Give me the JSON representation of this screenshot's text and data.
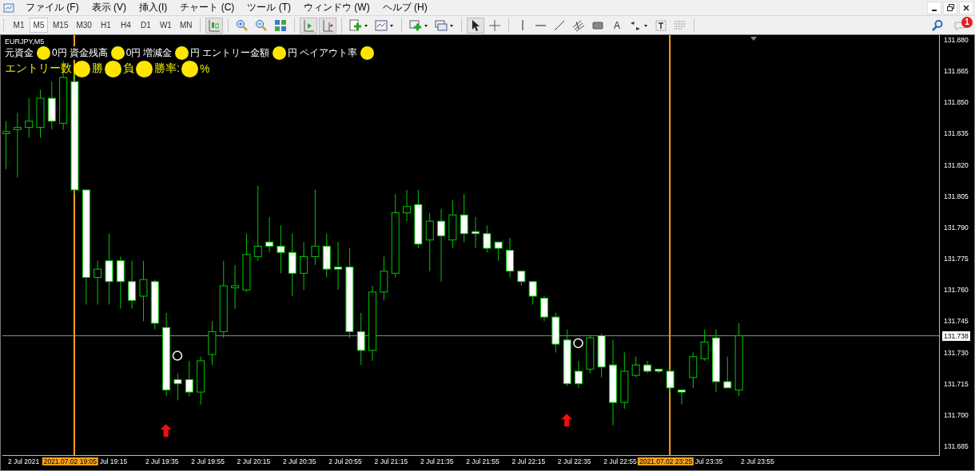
{
  "menu": [
    {
      "label": "ファイル (F)"
    },
    {
      "label": "表示 (V)"
    },
    {
      "label": "挿入(I)"
    },
    {
      "label": "チャート (C)"
    },
    {
      "label": "ツール (T)"
    },
    {
      "label": "ウィンドウ (W)"
    },
    {
      "label": "ヘルプ (H)"
    }
  ],
  "timeframes": [
    {
      "label": "M1",
      "selected": false
    },
    {
      "label": "M5",
      "selected": true
    },
    {
      "label": "M15",
      "selected": false
    },
    {
      "label": "M30",
      "selected": false
    },
    {
      "label": "H1",
      "selected": false
    },
    {
      "label": "H4",
      "selected": false
    },
    {
      "label": "D1",
      "selected": false
    },
    {
      "label": "W1",
      "selected": false
    },
    {
      "label": "MN",
      "selected": false
    }
  ],
  "text_tool_label": "A",
  "notifications": {
    "count": "1"
  },
  "chart": {
    "symbol": "EURJPY,M5",
    "info_line": [
      {
        "kind": "text",
        "text": "元資金 "
      },
      {
        "kind": "dot"
      },
      {
        "kind": "text",
        "text": "0円"
      },
      {
        "kind": "text",
        "text": "資金残高"
      },
      {
        "kind": "dot"
      },
      {
        "kind": "text",
        "text": "0円"
      },
      {
        "kind": "text",
        "text": "増減金"
      },
      {
        "kind": "dot"
      },
      {
        "kind": "text",
        "text": "円"
      },
      {
        "kind": "text",
        "text": "エントリー金額"
      },
      {
        "kind": "dot"
      },
      {
        "kind": "text",
        "text": "円"
      },
      {
        "kind": "text",
        "text": "ペイアウト率"
      },
      {
        "kind": "dot"
      }
    ],
    "stats_line": [
      {
        "kind": "text",
        "text": "エントリー数"
      },
      {
        "kind": "dot"
      },
      {
        "kind": "text",
        "text": "勝"
      },
      {
        "kind": "dot"
      },
      {
        "kind": "text",
        "text": "負"
      },
      {
        "kind": "dot"
      },
      {
        "kind": "text",
        "text": "勝率:"
      },
      {
        "kind": "dot"
      },
      {
        "kind": "text",
        "text": "%"
      }
    ],
    "price_ticks": [
      "131.880",
      "131.865",
      "131.850",
      "131.835",
      "131.820",
      "131.805",
      "131.790",
      "131.775",
      "131.760",
      "131.745",
      "131.730",
      "131.715",
      "131.700",
      "131.685"
    ],
    "current_price": "131.738",
    "time_labels": [
      "2 Jul 2021",
      "Jul 19:15",
      "2 Jul 19:35",
      "2 Jul 19:55",
      "2 Jul 20:15",
      "2 Jul 20:35",
      "2 Jul 20:55",
      "2 Jul 21:15",
      "2 Jul 21:35",
      "2 Jul 21:55",
      "2 Jul 22:15",
      "2 Jul 22:35",
      "2 Jul 22:55",
      "Jul 23:35",
      "2 Jul 23:55"
    ],
    "time_markers": [
      "2021.07.02 19:05",
      "2021.07.02 23:25"
    ]
  }
}
